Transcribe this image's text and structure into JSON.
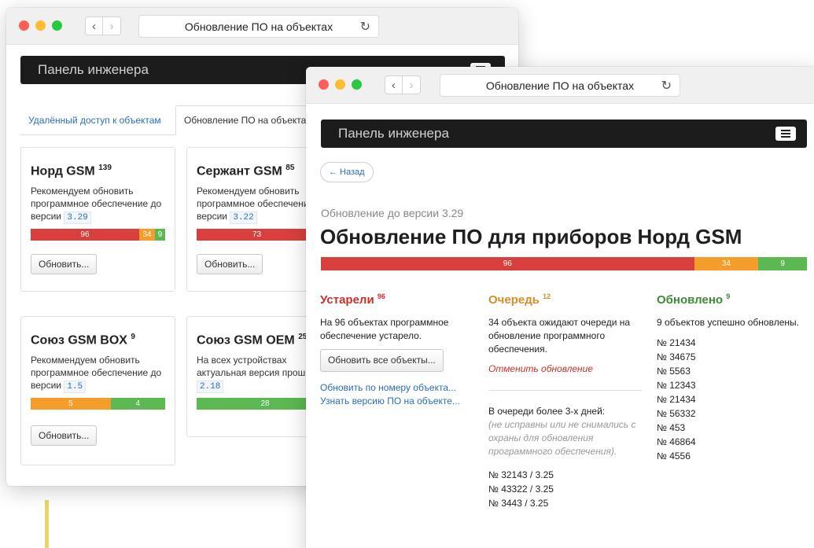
{
  "browser": {
    "url_title": "Обновление ПО на объектах"
  },
  "navbar": {
    "title": "Панель инженера"
  },
  "tabs": [
    "Удалённый доступ к объектам",
    "Обновление ПО на объекта"
  ],
  "cards": [
    {
      "name": "Норд GSM",
      "count": "139",
      "text": "Рекомендуем обновить программное обеспечение до версии",
      "version": "3.29",
      "bar": [
        "96",
        "34",
        "9"
      ],
      "button": "Обновить..."
    },
    {
      "name": "Сержант GSM",
      "count": "85",
      "text": "Рекомендуем обновить программное обеспечение до версии",
      "version": "3.22",
      "bar": [
        "73",
        "",
        ""
      ],
      "button": "Обновить..."
    },
    {
      "name": "Союз GSM BOX",
      "count": "9",
      "text": "Рекоммендуем обновить программное обеспечение до версии",
      "version": "1.5",
      "bar": [
        "5",
        "4"
      ],
      "button": "Обновить..."
    },
    {
      "name": "Союз GSM OEM",
      "count": "25",
      "text": "На всех устройствах актуальная версия прошивки",
      "version": "2.18",
      "bar": [
        "28"
      ],
      "button": ""
    }
  ],
  "detail": {
    "back": "← Назад",
    "subtitle": "Обновление до версии 3.29",
    "title": "Обновление ПО для приборов Норд GSM",
    "bar": {
      "outdated": 96,
      "queued": 34,
      "updated": 9
    },
    "outdated": {
      "title": "Устарели",
      "count": "96",
      "text": "На 96 объектах программное обеспечение устарело.",
      "button": "Обновить все объекты...",
      "link1": "Обновить по номеру объекта...",
      "link2": "Узнать версию ПО на объекте..."
    },
    "queue": {
      "title": "Очередь",
      "count": "12",
      "text": "34 объекта ожидают очереди на обновление программного обеспечения.",
      "cancel": "Отменить обновление",
      "stale_title": "В очереди более 3-х дней:",
      "stale_note": "(не исправны или не снимались с охраны для обновления программного обеспечения).",
      "stale_items": [
        "№ 32143 / 3.25",
        "№ 43322 / 3.25",
        "№ 3443 / 3.25"
      ]
    },
    "updated": {
      "title": "Обновлено",
      "count": "9",
      "text": "9 объектов успешно обновлены.",
      "items": [
        "№ 21434",
        "№ 34675",
        "№ 5563",
        "№ 12343",
        "№ 21434",
        "№ 56332",
        "№ 453",
        "№ 46864",
        "№ 4556"
      ]
    }
  },
  "colors": {
    "red": "#d9403d",
    "orange": "#f59d2a",
    "green": "#5cb853",
    "link": "#2a6eb8"
  }
}
